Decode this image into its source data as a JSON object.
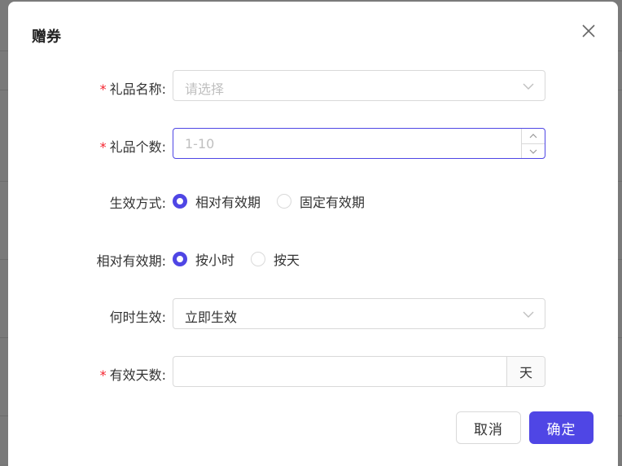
{
  "dialog": {
    "title": "赠券",
    "close_icon": "close-icon"
  },
  "form": {
    "gift_name": {
      "label": "礼品名称:",
      "required": true,
      "placeholder": "请选择"
    },
    "gift_count": {
      "label": "礼品个数:",
      "required": true,
      "placeholder": "1-10"
    },
    "effect_mode": {
      "label": "生效方式:",
      "options": [
        "相对有效期",
        "固定有效期"
      ],
      "selected": "相对有效期"
    },
    "relative_period": {
      "label": "相对有效期:",
      "options": [
        "按小时",
        "按天"
      ],
      "selected": "按小时"
    },
    "when_effective": {
      "label": "何时生效:",
      "value": "立即生效"
    },
    "valid_days": {
      "label": "有效天数:",
      "required": true,
      "value": "",
      "suffix": "天"
    }
  },
  "footer": {
    "cancel_label": "取消",
    "ok_label": "确定"
  },
  "colors": {
    "primary": "#4f46e5",
    "required": "#f5222d",
    "border": "#d9d9d9"
  }
}
